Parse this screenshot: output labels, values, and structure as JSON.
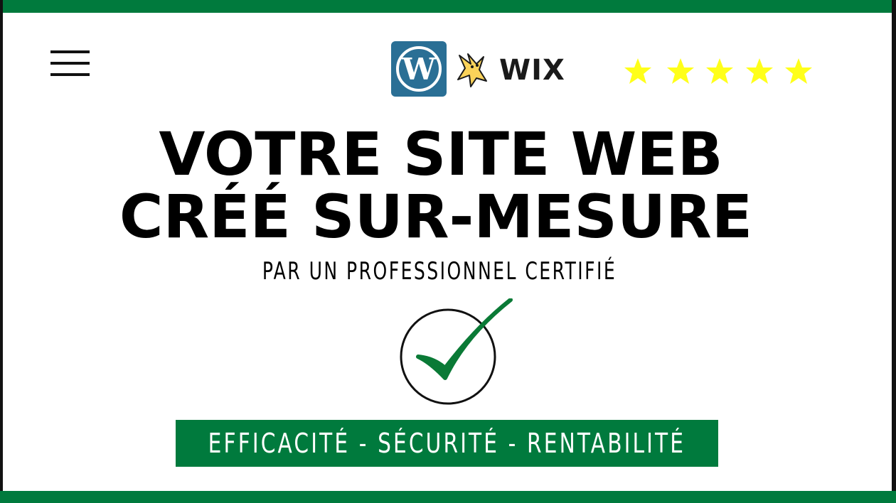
{
  "menu": {
    "icon": "hamburger-menu-icon"
  },
  "logos": {
    "wordpress": {
      "icon": "wordpress-logo-icon",
      "color": "#2a6f95"
    },
    "wix": {
      "text": "WIX",
      "icon": "wix-mascot-icon"
    }
  },
  "rating": {
    "stars": 5,
    "color": "#ffff1a"
  },
  "headline": {
    "line1": "VOTRE SITE WEB",
    "line2": "CRÉÉ SUR-MESURE"
  },
  "subtitle": "PAR UN PROFESSIONNEL CERTIFIÉ",
  "checkmark": {
    "icon": "check-circle-icon",
    "color": "#0a7a36"
  },
  "banner": {
    "text": "EFFICACITÉ - SÉCURITÉ - RENTABILITÉ",
    "color": "#007a3d"
  },
  "brand_color": "#007a3d"
}
